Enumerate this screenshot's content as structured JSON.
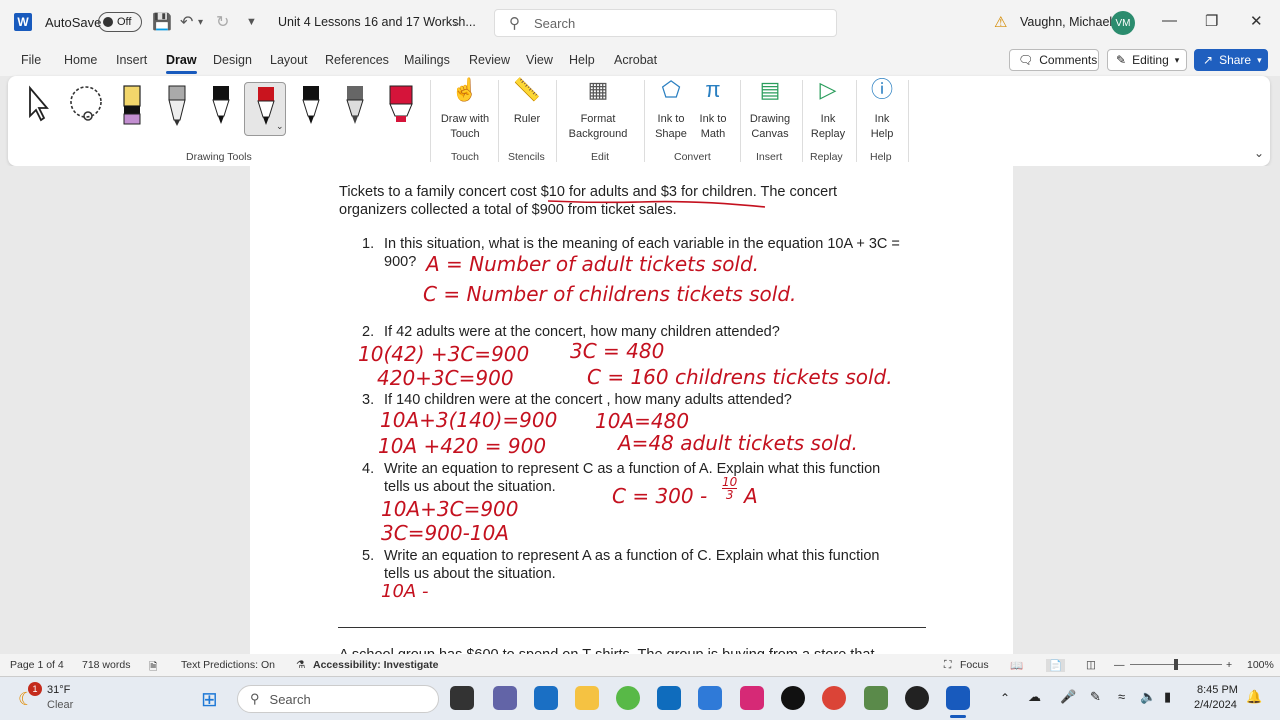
{
  "titlebar": {
    "app_letter": "W",
    "autosave": "AutoSave",
    "autosave_state": "Off",
    "doc_title": "Unit 4 Lessons 16 and 17 Worksh...",
    "search": "Search",
    "user": "Vaughn, Michael",
    "initials": "VM"
  },
  "menu": [
    "File",
    "Home",
    "Insert",
    "Draw",
    "Design",
    "Layout",
    "References",
    "Mailings",
    "Review",
    "View",
    "Help",
    "Acrobat"
  ],
  "menu_active": "Draw",
  "right_buttons": {
    "comments": "Comments",
    "editing": "Editing",
    "share": "Share"
  },
  "ribbon": {
    "groups": {
      "drawing_tools": "Drawing Tools",
      "touch": "Touch",
      "stencils": "Stencils",
      "edit": "Edit",
      "convert": "Convert",
      "insert": "Insert",
      "replay": "Replay",
      "help": "Help"
    },
    "buttons": {
      "draw_touch_1": "Draw with",
      "draw_touch_2": "Touch",
      "ruler": "Ruler",
      "format_bg_1": "Format",
      "format_bg_2": "Background",
      "ink_shape_1": "Ink to",
      "ink_shape_2": "Shape",
      "ink_math_1": "Ink to",
      "ink_math_2": "Math",
      "canvas_1": "Drawing",
      "canvas_2": "Canvas",
      "ink_replay_1": "Ink",
      "ink_replay_2": "Replay",
      "ink_help_1": "Ink",
      "ink_help_2": "Help"
    }
  },
  "document": {
    "intro_1": "Tickets to a family concert cost $10 for adults and $3 for children. The concert",
    "intro_2": "organizers collected a total of $900 from ticket sales.",
    "q1_num": "1.",
    "q1_a": "In this situation, what is the meaning of each variable in the equation 10A + 3C =",
    "q1_b": "900?",
    "q2_num": "2.",
    "q2": "If 42 adults were at the concert, how many children attended?",
    "q3_num": "3.",
    "q3": "If 140 children were at the concert , how many adults attended?",
    "q4_num": "4.",
    "q4_a": "Write an equation to represent C as a function of A. Explain what this function",
    "q4_b": "tells us about the situation.",
    "q5_num": "5.",
    "q5_a": "Write an equation to represent A as a function of C. Explain what this function",
    "q5_b": "tells us about the situation.",
    "next_problem": "A school group has $600 to spend on T-shirts. The group is buying from a store that"
  },
  "handwriting": {
    "h1": "A = Number of adult tickets sold.",
    "h2": "C = Number of childrens tickets sold.",
    "h3": "10(42) +3C=900",
    "h4": "420+3C=900",
    "h5": "3C = 480",
    "h6": "C = 160 childrens tickets sold.",
    "h7": "10A+3(140)=900",
    "h8": "10A +420 = 900",
    "h9": "10A=480",
    "h10": "A=48 adult tickets sold.",
    "h11": "10A+3C=900",
    "h12": "3C=900-10A",
    "h13": "C = 300 -",
    "h13_num": "10",
    "h13_den": "3",
    "h13_var": "A",
    "h14": "10A -"
  },
  "status": {
    "page": "Page 1 of 4",
    "words": "718 words",
    "predictions": "Text Predictions: On",
    "accessibility": "Accessibility: Investigate",
    "focus": "Focus",
    "zoom": "100%"
  },
  "taskbar": {
    "temp": "31°F",
    "weather": "Clear",
    "weather_badge": "1",
    "search": "Search",
    "time": "8:45 PM",
    "date": "2/4/2024"
  }
}
